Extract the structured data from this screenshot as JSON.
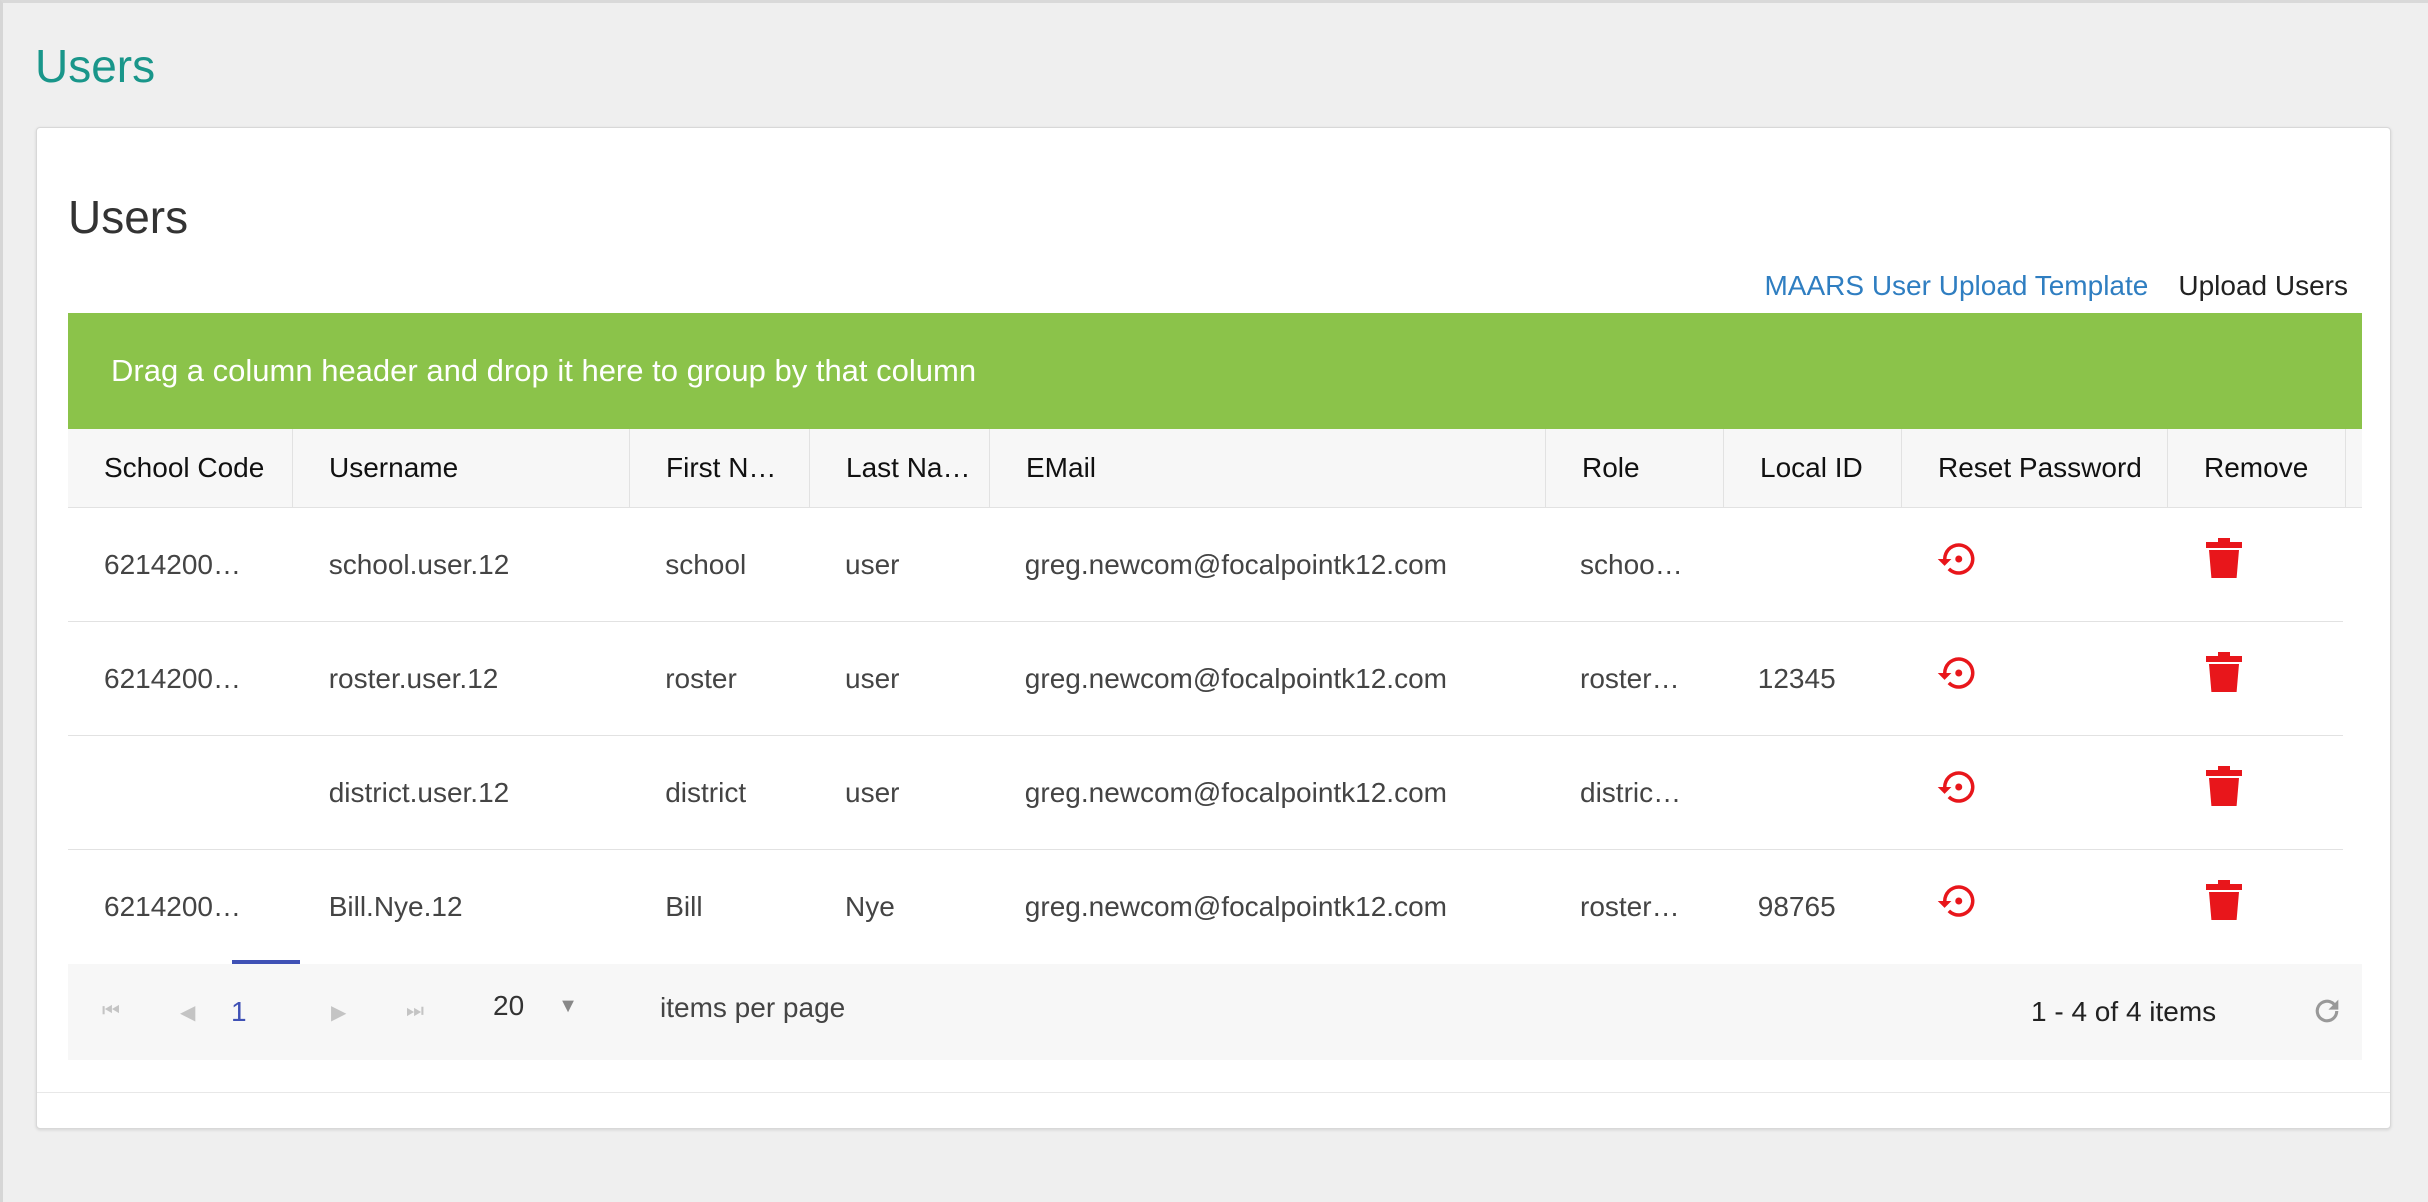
{
  "page": {
    "title": "Users"
  },
  "card": {
    "title": "Users",
    "links": {
      "template": "MAARS User Upload Template",
      "upload": "Upload Users"
    }
  },
  "grid": {
    "group_hint": "Drag a column header and drop it here to group by that column",
    "columns": [
      "School Code",
      "Username",
      "First N…",
      "Last Na…",
      "EMail",
      "Role",
      "Local ID",
      "Reset Password",
      "Remove"
    ],
    "rows": [
      {
        "school_code": "6214200…",
        "username": "school.user.12",
        "first": "school",
        "last": "user",
        "email": "greg.newcom@focalpointk12.com",
        "role": "schoo…",
        "local_id": ""
      },
      {
        "school_code": "6214200…",
        "username": "roster.user.12",
        "first": "roster",
        "last": "user",
        "email": "greg.newcom@focalpointk12.com",
        "role": "roster…",
        "local_id": "12345"
      },
      {
        "school_code": "",
        "username": "district.user.12",
        "first": "district",
        "last": "user",
        "email": "greg.newcom@focalpointk12.com",
        "role": "distric…",
        "local_id": ""
      },
      {
        "school_code": "6214200…",
        "username": "Bill.Nye.12",
        "first": "Bill",
        "last": "Nye",
        "email": "greg.newcom@focalpointk12.com",
        "role": "roster…",
        "local_id": "98765"
      }
    ],
    "icons": {
      "reset": "reset-password-icon",
      "remove": "trash-icon"
    },
    "accent_color": "#8bc34a",
    "danger_color": "#e8161b"
  },
  "pager": {
    "current_page": "1",
    "page_size": "20",
    "page_size_label": "items per page",
    "info": "1 - 4 of 4 items"
  }
}
